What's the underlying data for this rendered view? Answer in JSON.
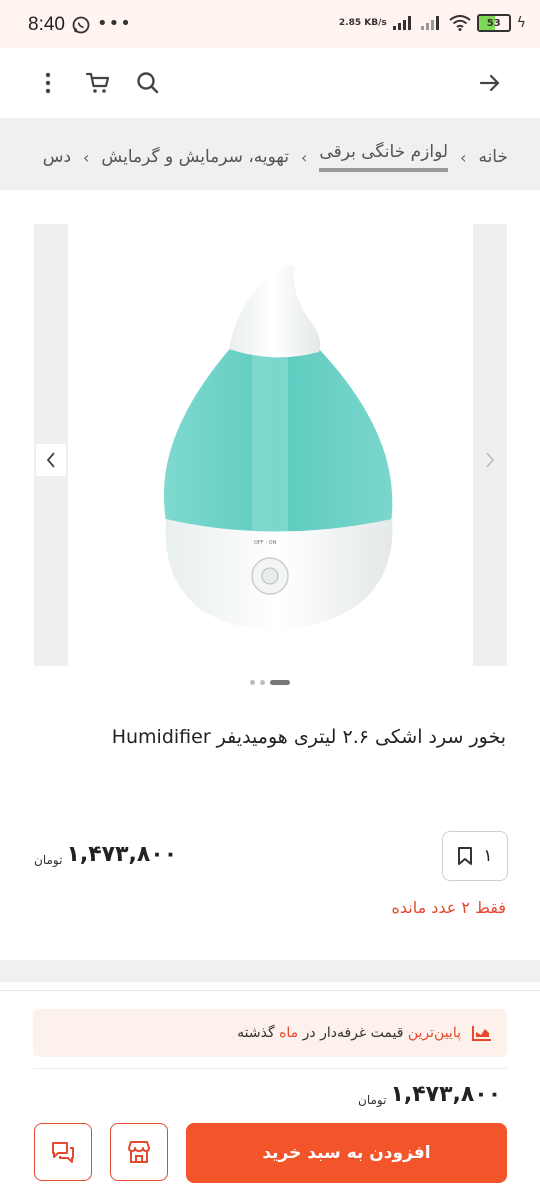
{
  "status_bar": {
    "time": "8:40",
    "network_speed": "2.85 KB/s",
    "battery": "53"
  },
  "header": {
    "back_icon": "arrow-right-icon",
    "search_icon": "search-icon",
    "cart_icon": "cart-icon",
    "more_icon": "more-vertical-icon"
  },
  "breadcrumb": {
    "items": [
      "خانه",
      "لوازم خانگی برقی",
      "تهویه، سرمایش و گرمایش",
      "دس"
    ]
  },
  "gallery": {
    "image_alt": "بخور سرد اشکی",
    "knob_label": "OFF - ON",
    "prev_icon": "chevron-left-icon",
    "next_icon": "chevron-right-icon"
  },
  "product": {
    "title": "بخور سرد اشکی ۲.۶ لیتری هومیدیفر Humidifier",
    "price": "۱,۴۷۳,۸۰۰",
    "currency": "تومان",
    "quantity": "۱",
    "stock_note": "فقط ۲ عدد مانده"
  },
  "bottom_bar": {
    "lowest_price_prefix": "پایین‌ترین",
    "lowest_price_middle": " قیمت غرفه‌دار در ",
    "lowest_price_highlight": "ماه",
    "lowest_price_suffix": " گذشته",
    "price": "۱,۴۷۳,۸۰۰",
    "currency": "تومان",
    "add_to_cart_label": "افزودن به سبد خرید"
  },
  "colors": {
    "accent": "#f4542a",
    "status_bg": "#fff4f0",
    "banner_bg": "#fdf1ec"
  }
}
